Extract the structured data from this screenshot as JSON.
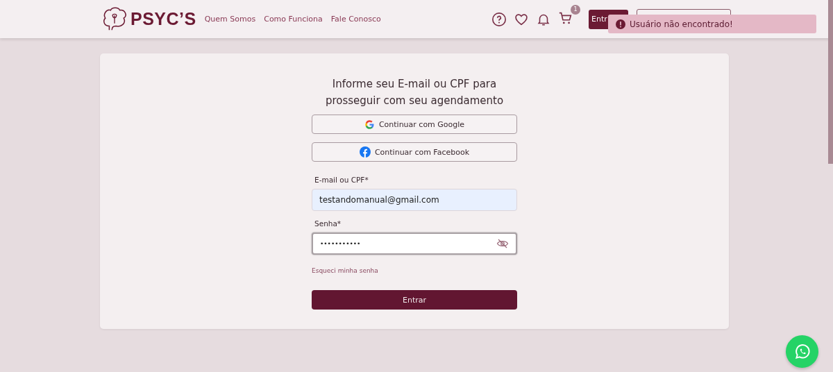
{
  "header": {
    "brand": "PSYC’S",
    "nav": [
      {
        "label": "Quem Somos"
      },
      {
        "label": "Como Funciona"
      },
      {
        "label": "Fale Conosco"
      }
    ],
    "cart_count": "1",
    "login_button": "Entr"
  },
  "toast": {
    "message": "Usuário não encontrado!"
  },
  "form": {
    "title": "Informe seu E-mail ou CPF para prosseguir com seu agendamento",
    "social": [
      {
        "kind": "google",
        "label": "Continuar com Google"
      },
      {
        "kind": "facebook",
        "label": "Continuar com Facebook"
      }
    ],
    "fields": [
      {
        "label": "E-mail ou CPF*",
        "value": "testandomanual@gmail.com",
        "kind": "autofill",
        "focused": false
      },
      {
        "label": "Senha*",
        "value": "•••••••••••",
        "kind": "password",
        "focused": true
      }
    ],
    "forgot_link": "Esqueci minha senha",
    "submit": "Entrar"
  }
}
